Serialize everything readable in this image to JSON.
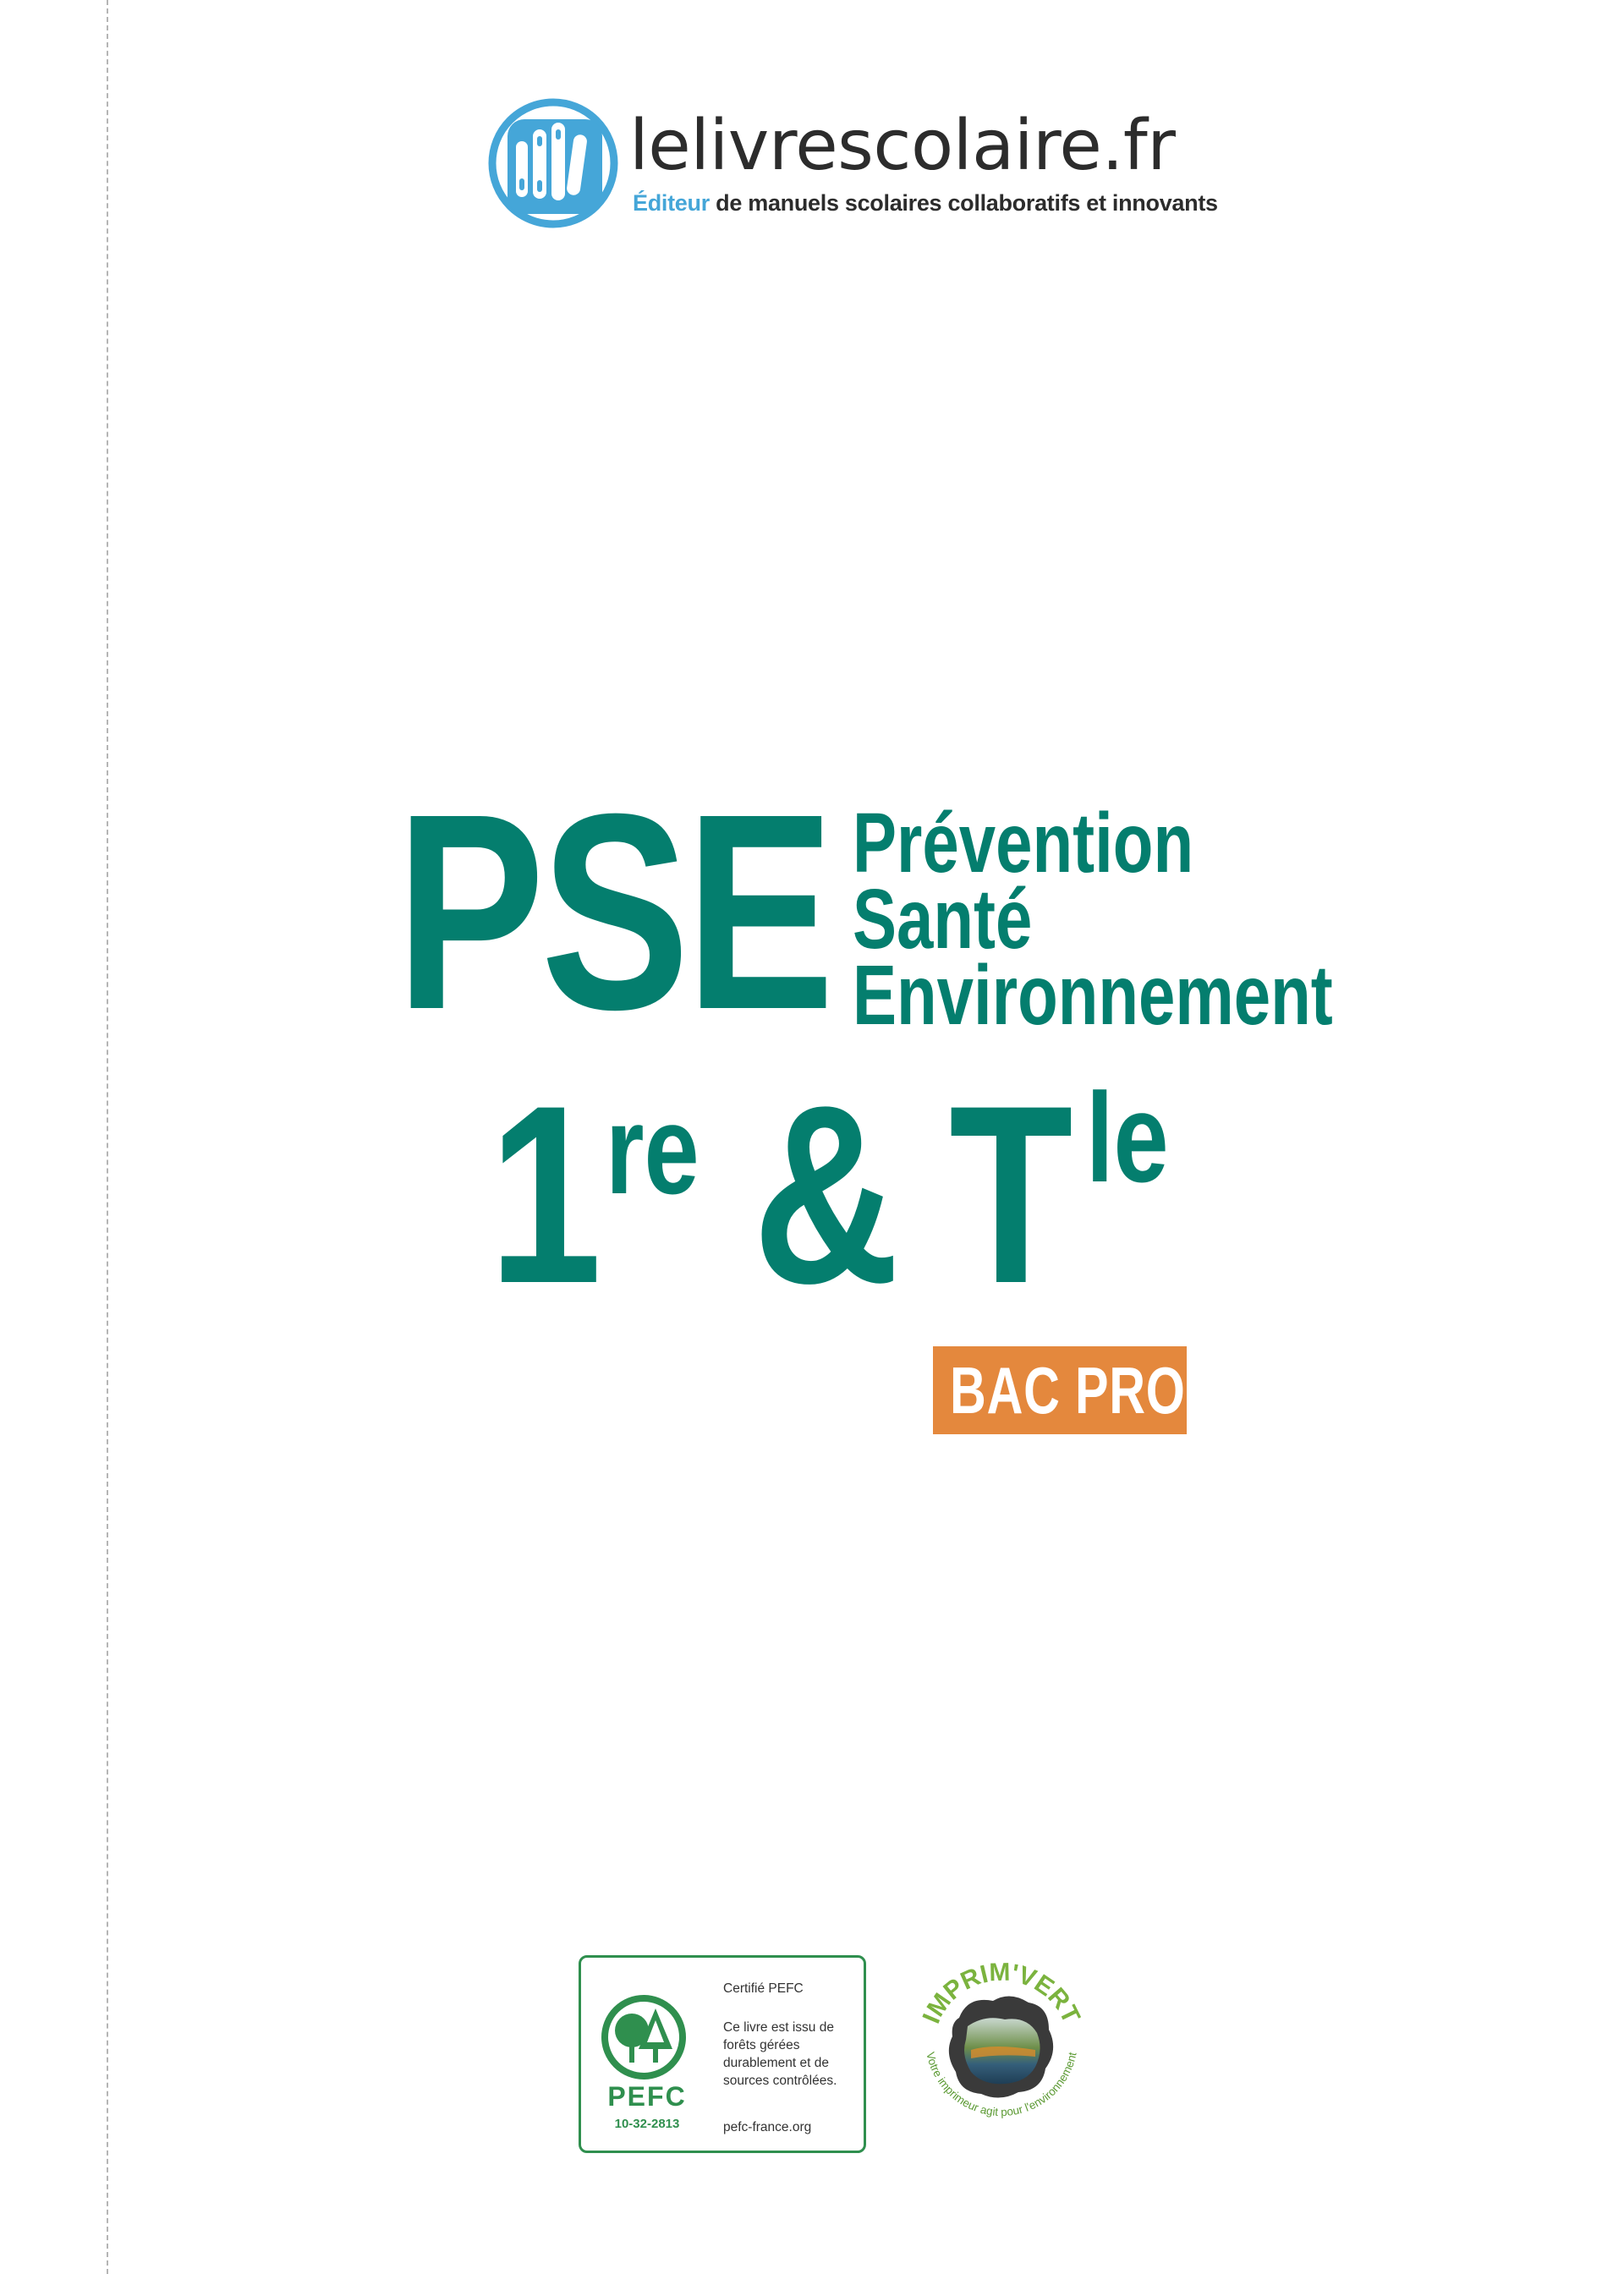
{
  "publisher": {
    "name": "lelivrescolaire.fr",
    "tagline_accent": "Éditeur",
    "tagline_rest": " de manuels scolaires collaboratifs et innovants"
  },
  "title": {
    "acronym": "PSE",
    "subtitle_lines": [
      "Prévention",
      "Santé",
      "Environnement"
    ],
    "grade_first": "1",
    "grade_first_sup": "re",
    "ampersand": "&",
    "grade_second": "T",
    "grade_second_sup": "le",
    "level_badge": "BAC PRO"
  },
  "certifications": {
    "pefc": {
      "certified": "Certifié PEFC",
      "description": "Ce livre est issu de forêts gérées durablement et de sources contrôlées.",
      "website": "pefc-france.org",
      "logo_word": "PEFC",
      "number": "10-32-2813"
    },
    "imprim_vert": {
      "name": "IMPRIM'VERT",
      "slogan": "Votre imprimeur agit pour l'environnement"
    }
  },
  "colors": {
    "teal": "#047e6e",
    "orange": "#e4883d",
    "logo_blue": "#45a6d8",
    "pefc_green": "#2f8f4e"
  }
}
